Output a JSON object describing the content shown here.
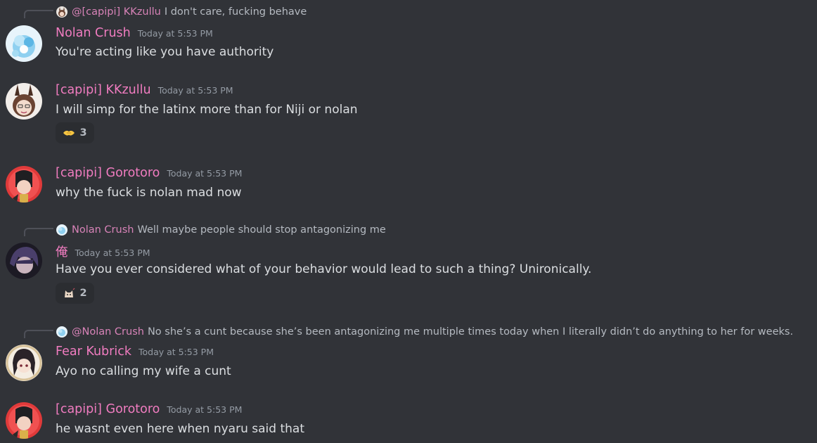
{
  "messages": [
    {
      "reply": {
        "name": "@[capipi] KKzullu",
        "text": "I don't care, fucking behave",
        "avatar_icon": "kkzullu-avatar-icon"
      },
      "author": "Nolan Crush",
      "timestamp": "Today at 5:53 PM",
      "content": "You're acting like you have authority",
      "avatar_icon": "nolan-avatar-icon"
    },
    {
      "author": "[capipi] KKzullu",
      "timestamp": "Today at 5:53 PM",
      "content": "I will simp for the latinx more than for Niji or nolan",
      "avatar_icon": "kkzullu-avatar-icon",
      "reaction": {
        "emoji": "handshake-icon",
        "count": "3"
      }
    },
    {
      "author": "[capipi] Gorotoro",
      "timestamp": "Today at 5:53 PM",
      "content": "why the fuck is nolan mad now",
      "avatar_icon": "gorotoro-avatar-icon"
    },
    {
      "reply": {
        "name": "Nolan Crush",
        "text": "Well maybe people should stop antagonizing me",
        "avatar_icon": "nolan-avatar-icon"
      },
      "author": "俺",
      "timestamp": "Today at 5:53 PM",
      "content": "Have you ever considered what of your behavior would lead to such a thing? Unironically.",
      "avatar_icon": "ore-avatar-icon",
      "reaction": {
        "emoji": "cat-icon",
        "count": "2"
      }
    },
    {
      "reply": {
        "name": "@Nolan Crush",
        "text": "No she’s a cunt because she’s been antagonizing me multiple times today when I literally didn’t do anything to her for weeks.",
        "avatar_icon": "nolan-avatar-icon"
      },
      "author": "Fear Kubrick",
      "timestamp": "Today at 5:53 PM",
      "content": "Ayo no calling my wife a cunt",
      "avatar_icon": "fear-avatar-icon"
    },
    {
      "author": "[capipi] Gorotoro",
      "timestamp": "Today at 5:53 PM",
      "content": "he wasnt even here when nyaru said that",
      "avatar_icon": "gorotoro-avatar-icon"
    }
  ],
  "colors": {
    "background": "#313338",
    "username": "#f07cc0",
    "reply_name": "#d883b8",
    "timestamp": "#949ba4",
    "text": "#dbdee1"
  }
}
